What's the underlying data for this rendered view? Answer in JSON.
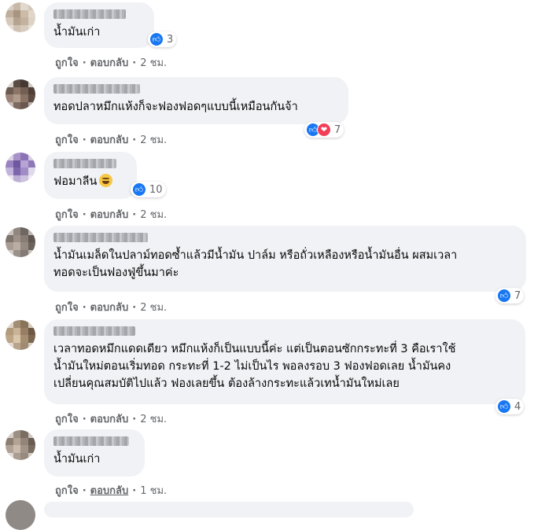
{
  "comments": [
    {
      "text_lines": [
        "น้ำมันเก่า"
      ],
      "reaction_count": "3",
      "like_label": "ถูกใจ",
      "reply_label": "ตอบกลับ",
      "time": "2 ชม.",
      "reactions": [
        "like"
      ]
    },
    {
      "text_lines": [
        "ทอดปลาหมึกแห้งก็จะฟองฟอดๆแบบนี้เหมือนกันจ้า"
      ],
      "reaction_count": "7",
      "like_label": "ถูกใจ",
      "reply_label": "ตอบกลับ",
      "time": "2 ชม.",
      "reactions": [
        "like",
        "love"
      ]
    },
    {
      "text_lines": [
        "ฟอมาลีน"
      ],
      "reaction_count": "10",
      "like_label": "ถูกใจ",
      "reply_label": "ตอบกลับ",
      "time": "2 ชม.",
      "reactions": [
        "like"
      ],
      "emoji": "grinning-emoji"
    },
    {
      "text_lines": [
        "น้ำมันเมล็ดในปลาม์ทอดซ้ำแล้วมีน้ำมัน ปาล์ม หรือถั่วเหลืองหรือน้ำมันอื่น ผสมเวลา",
        "ทอดจะเป็นฟองฟู่ขึ้นมาค่ะ"
      ],
      "reaction_count": "7",
      "like_label": "ถูกใจ",
      "reply_label": "ตอบกลับ",
      "time": "2 ชม.",
      "reactions": [
        "like"
      ]
    },
    {
      "text_lines": [
        "เวลาทอดหมึกแดดเดียว หมึกแห้งก็เป็นแบบนี้ค่ะ แต่เป็นตอนซักกระทะที่ 3 คือเราใช้",
        "น้ำมันใหม่ตอนเริ่มทอด กระทะที่ 1-2 ไม่เป็นไร พอลงรอบ 3 ฟองฟอดเลย น้ำมันคง",
        "เปลี่ยนคุณสมบัติไปแล้ว ฟองเลยขึ้น ต้องล้างกระทะแล้วเทน้ำมันใหม่เลย"
      ],
      "reaction_count": "4",
      "like_label": "ถูกใจ",
      "reply_label": "ตอบกลับ",
      "time": "2 ชม.",
      "reactions": [
        "like"
      ]
    },
    {
      "text_lines": [
        "น้ำมันเก่า"
      ],
      "like_label": "ถูกใจ",
      "reply_label": "ตอบกลับ",
      "time": "1 ชม."
    }
  ],
  "colors": {
    "bubble": "#f0f2f5",
    "like": "#1877f2",
    "love": "#f33e58",
    "meta": "#65676b"
  }
}
